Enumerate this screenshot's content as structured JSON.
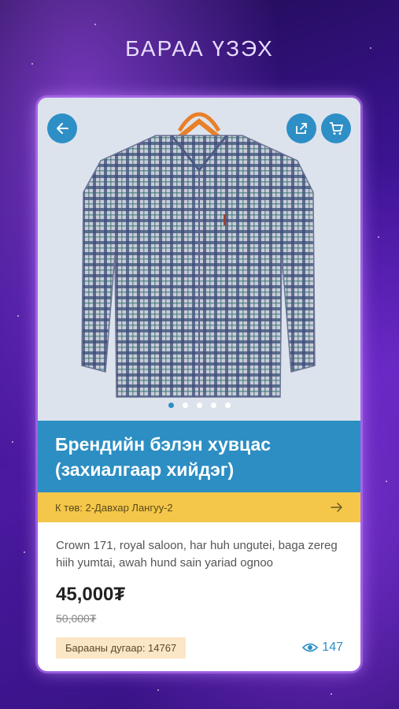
{
  "header": {
    "title": "БАРАА ҮЗЭХ"
  },
  "product": {
    "title_line1": "Брендийн бэлэн хувцас",
    "title_line2": "(захиалгаар хийдэг)",
    "location": "К төв: 2-Давхар Лангуу-2",
    "description": "Crown 171, royal saloon, har huh ungutei, baga zereg hiih yumtai, awah hund sain yariad ognoo",
    "price": "45,000₮",
    "old_price": "50,000₮",
    "code": "Барааны дугаар: 14767",
    "views": "147"
  },
  "gallery": {
    "total_images": 5,
    "active_index": 0
  },
  "icons": {
    "back": "arrow-left-icon",
    "share": "share-icon",
    "cart": "cart-icon",
    "location_arrow": "arrow-right-icon",
    "views": "eye-icon"
  },
  "colors": {
    "accent": "#2c8ec3",
    "location_bar": "#f4c74a",
    "badge": "#fbe6c6"
  }
}
